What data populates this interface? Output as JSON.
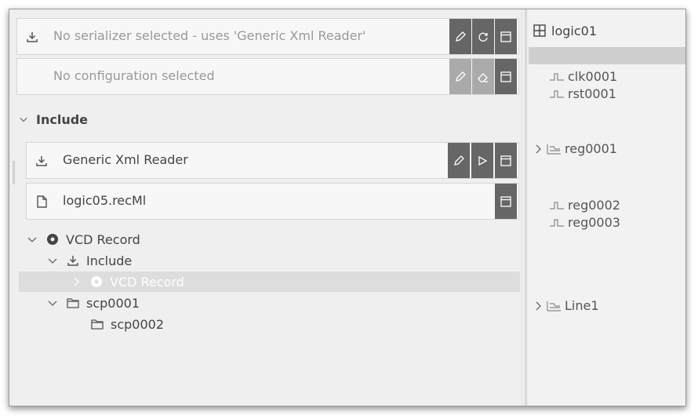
{
  "serializer": {
    "text": "No serializer selected - uses 'Generic Xml Reader'"
  },
  "configuration": {
    "text": "No configuration selected"
  },
  "include_section": {
    "label": "Include"
  },
  "include_items": [
    {
      "label": "Generic Xml Reader"
    },
    {
      "label": "logic05.recMl"
    }
  ],
  "tree": {
    "root": "VCD Record",
    "include": "Include",
    "nested_record": "VCD Record",
    "scope1": "scp0001",
    "scope2": "scp0002"
  },
  "signals_panel": {
    "title": "logic01",
    "signals": [
      "clk0001",
      "rst0001",
      "reg0001",
      "reg0002",
      "reg0003",
      "Line1"
    ]
  },
  "colors": {
    "button_dark": "#666666",
    "button_light": "#aaaaaa",
    "highlight": "#dddddd",
    "selection": "#cfcfcf"
  }
}
